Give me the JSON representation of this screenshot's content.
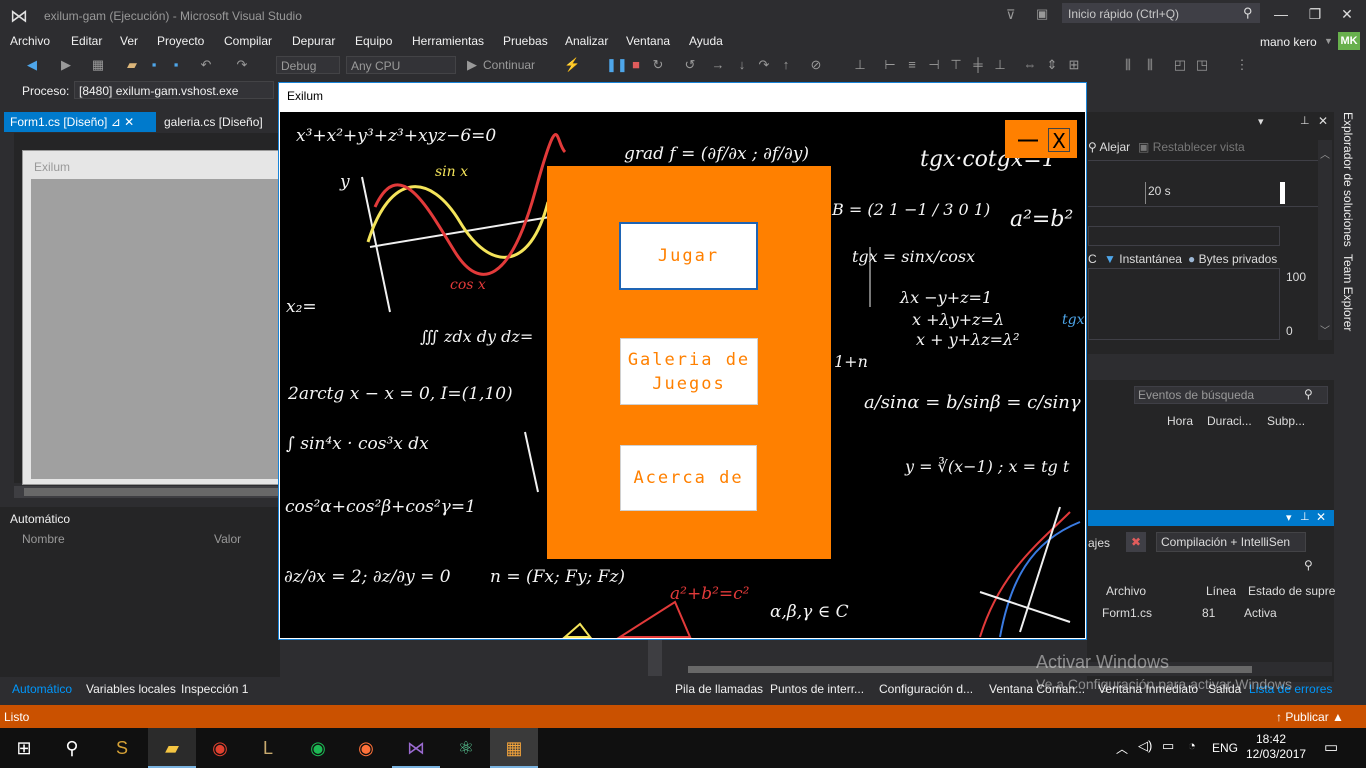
{
  "vs": {
    "title": "exilum-gam (Ejecución) - Microsoft Visual Studio",
    "quick_launch_placeholder": "Inicio rápido (Ctrl+Q)",
    "menu": [
      "Archivo",
      "Editar",
      "Ver",
      "Proyecto",
      "Compilar",
      "Depurar",
      "Equipo",
      "Herramientas",
      "Pruebas",
      "Analizar",
      "Ventana",
      "Ayuda"
    ],
    "user_name": "mano kero",
    "user_initials": "MK",
    "toolbar": {
      "config": "Debug",
      "platform": "Any CPU",
      "continue": "Continuar"
    },
    "process_label": "Proceso:",
    "process_value": "[8480] exilum-gam.vshost.exe",
    "doc_tabs": [
      "Form1.cs [Diseño]",
      "galeria.cs [Diseño]"
    ],
    "designer_form_title": "Exilum",
    "autos_panel": {
      "title": "Automático",
      "col_name": "Nombre",
      "col_value": "Valor"
    },
    "bottom_tabs_left": [
      "Automático",
      "Variables locales",
      "Inspección 1"
    ],
    "bottom_tabs_right": [
      "Pila de llamadas",
      "Puntos de interr...",
      "Configuración d...",
      "Ventana Coman...",
      "Ventana Inmediato",
      "Salida",
      "Lista de errores"
    ],
    "diag": {
      "zoom_out": "Alejar",
      "reset_view": "Restablecer vista",
      "time_tick": "20 s",
      "snapshot": "Instantánea",
      "private_bytes": "Bytes privados",
      "c_label": "C",
      "y_max": "100",
      "y_min": "0",
      "search_events": "Eventos de búsqueda",
      "col_time": "Hora",
      "col_duration": "Duraci...",
      "col_sub": "Subp..."
    },
    "errors": {
      "ajes_label": "ajes",
      "filter": "Compilación + IntelliSen",
      "col_file": "Archivo",
      "col_line": "Línea",
      "col_state": "Estado de supre:",
      "row_file": "Form1.cs",
      "row_line": "81",
      "row_state": "Activa"
    },
    "side_tabs": [
      "Explorador de soluciones",
      "Team Explorer"
    ],
    "status": "Listo",
    "publish": "Publicar",
    "watermark_title": "Activar Windows",
    "watermark_sub": "Ve a Configuración para activar Windows"
  },
  "app": {
    "window_title": "Exilum",
    "buttons": {
      "play": "Jugar",
      "gallery_line1": "Galeria de",
      "gallery_line2": "Juegos",
      "about": "Acerca de"
    },
    "minimize_glyph": "—",
    "close_glyph": "X"
  },
  "chalkboard": {
    "formulas": [
      "x³+x²+y³+z³+xyz−6=0",
      "sin x",
      "cos x",
      "y",
      "tgx·cotgx=1",
      "a²=b²",
      "x₂=",
      "∭ zdx dy dz=",
      "2arctg x − x = 0, I=(1,10)",
      "∫ sin⁴x · cos³x dx",
      "cos²α+cos²β+cos²γ=1",
      "∂z/∂x = 2; ∂z/∂y = 0",
      "n = (Fx; Fy; Fz)",
      "a²+b²=c²",
      "α,β,γ ∈ C",
      "tgx = sinx/cosx",
      "λx −y+z=1",
      "x +λy+z=λ",
      "x + y+λz=λ²",
      "a/sinα = b/sinβ = c/sinγ",
      "y = ∛(x−1) ; x = tg t",
      "grad f = (∂f/∂x ; ∂f/∂y)",
      "B = (2 1 −1 / 3 0 1)",
      "1+n",
      "tgx"
    ]
  }
}
